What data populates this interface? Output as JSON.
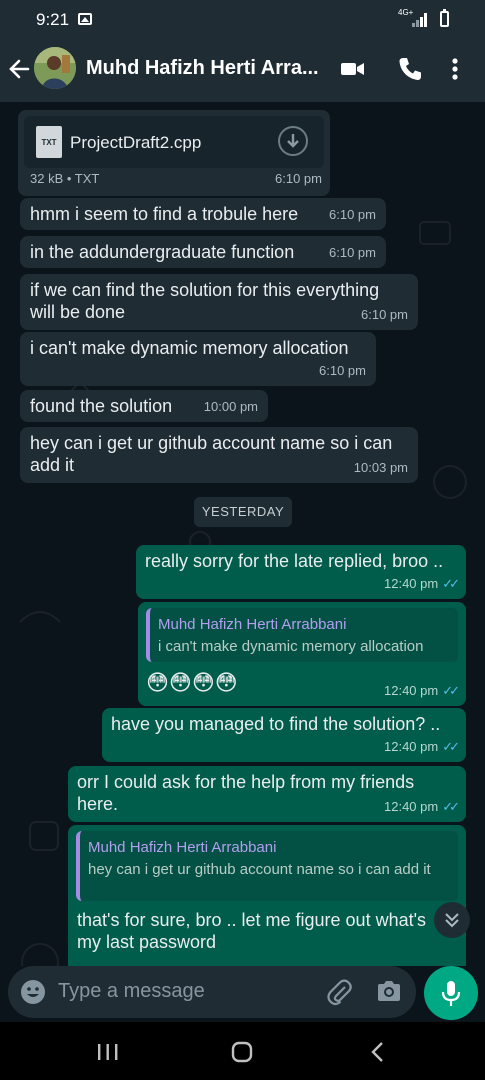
{
  "status_bar": {
    "time": "9:21",
    "network": "4G+",
    "icons": [
      "gallery-icon",
      "signal-icon",
      "battery-icon"
    ]
  },
  "header": {
    "contact_name": "Muhd Hafizh Herti Arra...",
    "icons": [
      "back-arrow-icon",
      "avatar",
      "video-call-icon",
      "phone-icon",
      "more-vert-icon"
    ]
  },
  "file_message": {
    "badge": "TXT",
    "file_name": "ProjectDraft2.cpp",
    "size_type": "32 kB • TXT",
    "time": "6:10 pm"
  },
  "messages_incoming": [
    {
      "text": "hmm i seem to find a trobule here",
      "time": "6:10 pm"
    },
    {
      "text": "in the addundergraduate function",
      "time": "6:10 pm"
    },
    {
      "text": "if we can find the solution for this everything will be done",
      "time": "6:10 pm"
    },
    {
      "text": "i can't make dynamic memory allocation",
      "time": "6:10 pm"
    },
    {
      "text": "found the solution",
      "time": "10:00 pm"
    },
    {
      "text": "hey can i get ur github account name so i can add it",
      "time": "10:03 pm"
    }
  ],
  "date_separator": "YESTERDAY",
  "messages_outgoing": [
    {
      "text": "really sorry for the late replied, broo ..",
      "time": "12:40 pm"
    },
    {
      "quote_name": "Muhd Hafizh Herti Arrabbani",
      "quote_text": "i can't make dynamic memory allocation",
      "text": "😳😳😳😳",
      "time": "12:40 pm"
    },
    {
      "text": "have you managed to find the solution? ..",
      "time": "12:40 pm"
    },
    {
      "text": "orr I could ask for the help from my friends here.",
      "time": "12:40 pm"
    },
    {
      "quote_name": "Muhd Hafizh Herti Arrabbani",
      "quote_text": "hey can i get ur github account name so i can add it",
      "text": "that's for sure, bro .. let me figure out what's my last password"
    }
  ],
  "composer": {
    "placeholder": "Type a message",
    "icons": [
      "emoji-icon",
      "attach-icon",
      "camera-icon",
      "mic-icon"
    ]
  },
  "colors": {
    "header": "#1f2c34",
    "background": "#0b141a",
    "incoming": "#1f2c34",
    "outgoing": "#005c4b",
    "accent": "#00a884",
    "read_ticks": "#53bdeb",
    "quote_name": "#b49ef0"
  }
}
